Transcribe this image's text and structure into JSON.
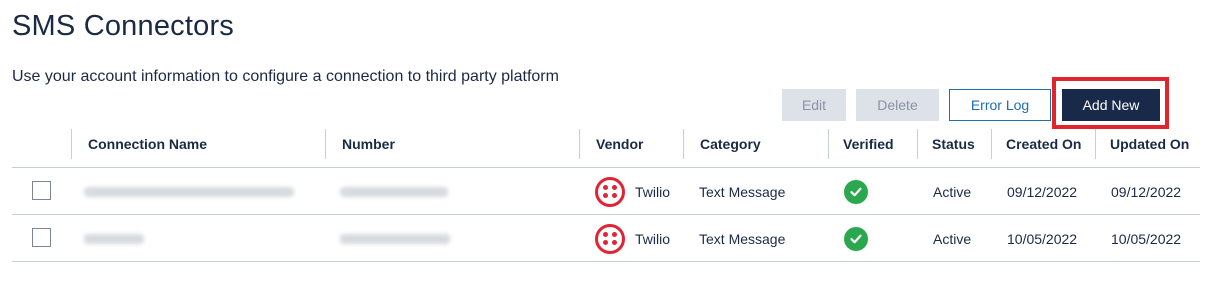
{
  "page": {
    "title": "SMS Connectors",
    "description": "Use your account information to configure a connection to third party platform"
  },
  "toolbar": {
    "edit_label": "Edit",
    "delete_label": "Delete",
    "error_log_label": "Error Log",
    "add_new_label": "Add New"
  },
  "table": {
    "headers": {
      "connection_name": "Connection Name",
      "number": "Number",
      "vendor": "Vendor",
      "category": "Category",
      "verified": "Verified",
      "status": "Status",
      "created_on": "Created On",
      "updated_on": "Updated On"
    },
    "rows": [
      {
        "connection_name": "",
        "number": "",
        "vendor": "Twilio",
        "vendor_icon": "twilio-logo-icon",
        "category": "Text Message",
        "verified": true,
        "status": "Active",
        "created_on": "09/12/2022",
        "updated_on": "09/12/2022"
      },
      {
        "connection_name": "",
        "number": "",
        "vendor": "Twilio",
        "vendor_icon": "twilio-logo-icon",
        "category": "Text Message",
        "verified": true,
        "status": "Active",
        "created_on": "10/05/2022",
        "updated_on": "10/05/2022"
      }
    ]
  },
  "colors": {
    "primary_navy": "#19294a",
    "link_blue": "#1d6fb0",
    "disabled_bg": "#dde1e8",
    "highlight_red": "#e0252d",
    "verified_green": "#2ba84f",
    "twilio_red": "#e02435"
  }
}
